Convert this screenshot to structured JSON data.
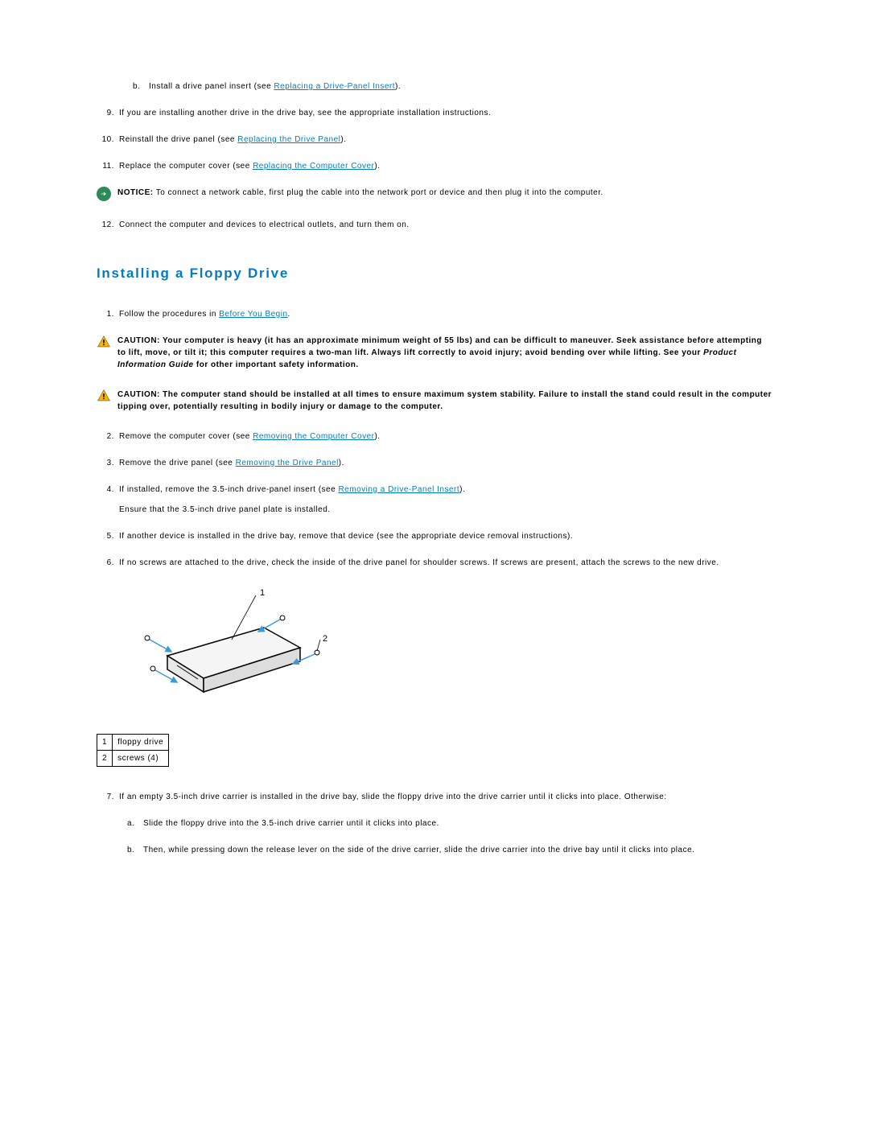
{
  "topSubItem": {
    "marker": "b.",
    "text_before": "Install a drive panel insert (see ",
    "link": "Replacing a Drive-Panel Insert",
    "text_after": ")."
  },
  "steps_upper": [
    {
      "n": "9.",
      "text": "If you are installing another drive in the drive bay, see the appropriate installation instructions."
    },
    {
      "n": "10.",
      "text_before": "Reinstall the drive panel (see ",
      "link": "Replacing the Drive Panel",
      "text_after": ")."
    },
    {
      "n": "11.",
      "text_before": "Replace the computer cover (see ",
      "link": "Replacing the Computer Cover",
      "text_after": ")."
    }
  ],
  "notice": {
    "label": "NOTICE:",
    "text": " To connect a network cable, first plug the cable into the network port or device and then plug it into the computer."
  },
  "step12": {
    "n": "12.",
    "text": "Connect the computer and devices to electrical outlets, and turn them on."
  },
  "heading": "Installing a Floppy Drive",
  "step1": {
    "n": "1.",
    "text_before": "Follow the procedures in ",
    "link": "Before You Begin",
    "text_after": "."
  },
  "caution1": {
    "label": "CAUTION:",
    "text_a": " Your computer is heavy (it has an approximate minimum weight of 55 lbs) and can be difficult to maneuver. Seek assistance before attempting to lift, move, or tilt it; this computer requires a two-man lift. Always lift correctly to avoid injury; avoid bending over while lifting. See your ",
    "ital": "Product Information Guide",
    "text_b": " for other important safety information."
  },
  "caution2": {
    "label": "CAUTION:",
    "text": " The computer stand should be installed at all times to ensure maximum system stability. Failure to install the stand could result in the computer tipping over, potentially resulting in bodily injury or damage to the computer."
  },
  "step2": {
    "n": "2.",
    "text_before": "Remove the computer cover (see ",
    "link": "Removing the Computer Cover",
    "text_after": ")."
  },
  "step3": {
    "n": "3.",
    "text_before": "Remove the drive panel (see ",
    "link": "Removing the Drive Panel",
    "text_after": ")."
  },
  "step4": {
    "n": "4.",
    "text_before": "If installed, remove the 3.5-inch drive-panel insert (see ",
    "link": "Removing a Drive-Panel Insert",
    "text_after": ").",
    "extra": "Ensure that the 3.5-inch drive panel plate is installed."
  },
  "step5": {
    "n": "5.",
    "text": "If another device is installed in the drive bay, remove that device (see the appropriate device removal instructions)."
  },
  "step6": {
    "n": "6.",
    "text": "If no screws are attached to the drive, check the inside of the drive panel for shoulder screws. If screws are present, attach the screws to the new drive."
  },
  "legend": {
    "r1n": "1",
    "r1t": "floppy drive",
    "r2n": "2",
    "r2t": "screws (4)"
  },
  "diagram_labels": {
    "l1": "1",
    "l2": "2"
  },
  "step7": {
    "n": "7.",
    "text": "If an empty 3.5-inch drive carrier is installed in the drive bay, slide the floppy drive into the drive carrier until it clicks into place. Otherwise:"
  },
  "sub7a": {
    "marker": "a.",
    "text": "Slide the floppy drive into the 3.5-inch drive carrier until it clicks into place."
  },
  "sub7b": {
    "marker": "b.",
    "text": "Then, while pressing down the release lever on the side of the drive carrier, slide the drive carrier into the drive bay until it clicks into place."
  }
}
